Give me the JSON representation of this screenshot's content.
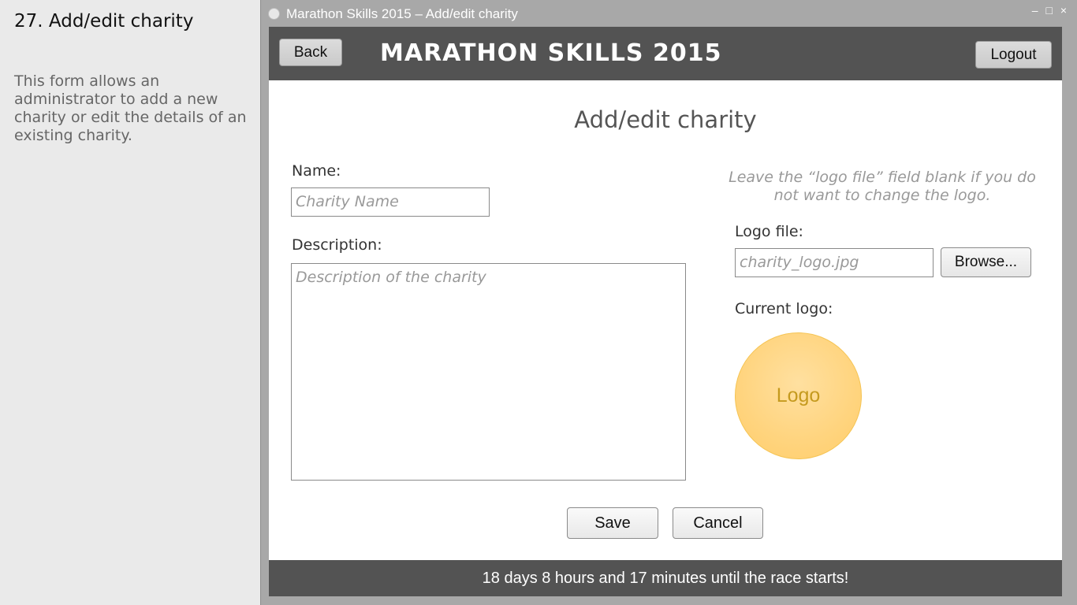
{
  "side": {
    "title": "27. Add/edit charity",
    "description": "This form allows an administrator to add a new charity or edit the details of an existing charity."
  },
  "window": {
    "title": "Marathon Skills 2015 – Add/edit charity",
    "controls": "– □ ×"
  },
  "header": {
    "back_label": "Back",
    "title": "MARATHON SKILLS 2015",
    "logout_label": "Logout"
  },
  "form": {
    "title": "Add/edit charity",
    "name_label": "Name:",
    "name_placeholder": "Charity Name",
    "description_label": "Description:",
    "description_placeholder": "Description of the charity",
    "hint": "Leave the “logo file” field blank if you do not want to change the logo.",
    "logo_file_label": "Logo file:",
    "logo_file_value": "charity_logo.jpg",
    "browse_label": "Browse...",
    "current_logo_label": "Current logo:",
    "logo_text": "Logo",
    "save_label": "Save",
    "cancel_label": "Cancel"
  },
  "footer": {
    "countdown": "18 days 8 hours and 17 minutes until the race starts!"
  },
  "colors": {
    "header_bg": "#535353",
    "logo_fill": "#ffd47e",
    "page_bg": "#eaeaea"
  }
}
